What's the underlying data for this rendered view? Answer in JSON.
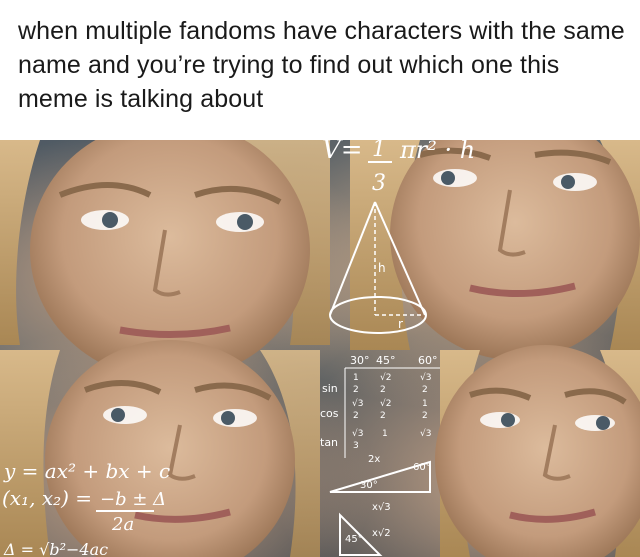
{
  "caption": {
    "text": "when multiple fandoms have characters with the same name and you’re trying to find out which one this meme is talking about"
  },
  "meme": {
    "volume_formula": "V = 1/3 πr² · h",
    "quadratic_formula": "y = ax² + bx + c",
    "roots_formula": "(x₁, x₂) = −b ± Δ / 2a",
    "trig_headers": [
      "30°",
      "45°",
      "60°"
    ],
    "trig_rows": [
      "sin",
      "cos",
      "tan"
    ],
    "triangle_labels": [
      "30°",
      "60°",
      "2x",
      "x√3",
      "45°",
      "x√2"
    ],
    "cone_label": "h"
  }
}
